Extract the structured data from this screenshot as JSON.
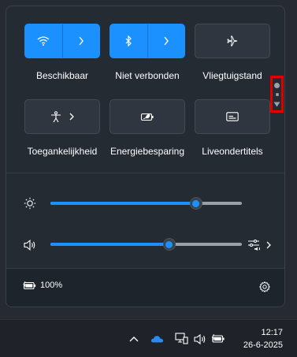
{
  "quick_settings": {
    "tiles": [
      {
        "label": "Beschikbaar",
        "icon": "wifi-icon",
        "state": "on"
      },
      {
        "label": "Niet verbonden",
        "icon": "bluetooth-icon",
        "state": "on"
      },
      {
        "label": "Vliegtuigstand",
        "icon": "airplane-icon",
        "state": "off"
      },
      {
        "label": "Toegankelijkheid",
        "icon": "accessibility-icon",
        "state": "off"
      },
      {
        "label": "Energiebesparing",
        "icon": "battery-saver-icon",
        "state": "off"
      },
      {
        "label": "Liveondertitels",
        "icon": "live-captions-icon",
        "state": "off"
      }
    ],
    "brightness": {
      "icon": "brightness-icon",
      "level_percent": 76
    },
    "volume": {
      "icon": "speaker-icon",
      "level_percent": 62
    },
    "footer": {
      "battery_label": "100%",
      "battery_icon": "battery-charging-icon",
      "settings_icon": "gear-icon"
    }
  },
  "taskbar": {
    "time": "12:17",
    "date": "26-6-2025",
    "tray_icons": [
      "chevron-up-icon",
      "onedrive-cloud-icon",
      "network-icon",
      "speaker-icon",
      "battery-charging-icon"
    ]
  },
  "colors": {
    "accent": "#1a91ff",
    "highlight_border": "#e10000"
  }
}
